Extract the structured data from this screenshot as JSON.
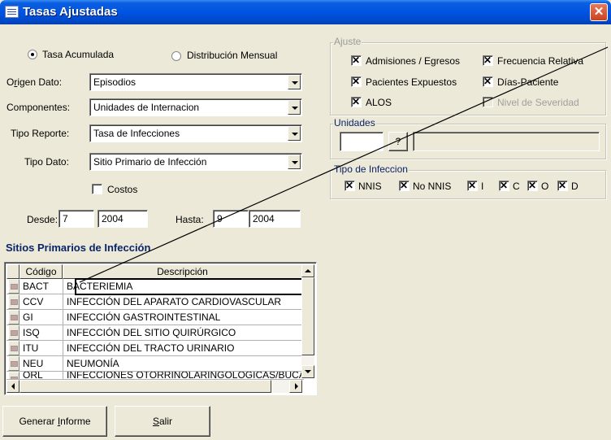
{
  "window": {
    "title": "Tasas Ajustadas",
    "close_glyph": "✕"
  },
  "rate_mode": {
    "accumulated_label": "Tasa Acumulada",
    "monthly_label": "Distribución Mensual",
    "selected": "accumulated"
  },
  "form": {
    "origen_label_pre": "O",
    "origen_label_ul": "r",
    "origen_label_post": "igen Dato:",
    "origen_value": "Episodios",
    "componentes_label": "Componentes:",
    "componentes_value": "Unidades de Internacion",
    "tipo_reporte_label": "Tipo Reporte:",
    "tipo_reporte_value": "Tasa de Infecciones",
    "tipo_dato_label": "Tipo Dato:",
    "tipo_dato_value": "Sitio Primario de Infección",
    "costos_label": "Costos",
    "desde_label": "Desde:",
    "desde_month": "7",
    "desde_year": "2004",
    "hasta_label": "Hasta:",
    "hasta_month": "9",
    "hasta_year": "2004"
  },
  "ajuste": {
    "title": "Ajuste",
    "items": [
      {
        "label": "Admisiones / Egresos",
        "checked": true
      },
      {
        "label": "Frecuencia Relativa",
        "checked": true
      },
      {
        "label": "Pacientes Expuestos",
        "checked": true
      },
      {
        "label": "Días-Paciente",
        "checked": true
      },
      {
        "label": "ALOS",
        "checked": true
      },
      {
        "label": "Nivel de Severidad",
        "checked": false,
        "disabled": true
      }
    ]
  },
  "unidades": {
    "title": "Unidades",
    "code_value": "",
    "lookup_label": "?",
    "name_value": ""
  },
  "tipo_infeccion": {
    "title": "Tipo de Infeccion",
    "items": [
      {
        "label": "NNIS",
        "checked": true
      },
      {
        "label": "No NNIS",
        "checked": true
      },
      {
        "label": "I",
        "checked": true
      },
      {
        "label": "C",
        "checked": true
      },
      {
        "label": "O",
        "checked": true
      },
      {
        "label": "D",
        "checked": true
      }
    ]
  },
  "sites": {
    "title": "Sitios Primarios de Infección",
    "columns": [
      "Código",
      "Descripción"
    ],
    "rows": [
      {
        "code": "BACT",
        "desc": "BACTERIEMIA"
      },
      {
        "code": "CCV",
        "desc": "INFECCIÓN DEL APARATO CARDIOVASCULAR"
      },
      {
        "code": "GI",
        "desc": "INFECCIÓN GASTROINTESTINAL"
      },
      {
        "code": "ISQ",
        "desc": "INFECCIÓN DEL SITIO QUIRÚRGICO"
      },
      {
        "code": "ITU",
        "desc": "INFECCIÓN DEL TRACTO URINARIO"
      },
      {
        "code": "NEU",
        "desc": "NEUMONÍA"
      },
      {
        "code": "ORL",
        "desc": "INFECCIONES OTORRINOLARINGOLÓGICAS/BUCALES"
      }
    ]
  },
  "buttons": {
    "generar_pre": "Generar ",
    "generar_ul": "I",
    "generar_post": "nforme",
    "salir_ul": "S",
    "salir_post": "alir"
  },
  "colors": {
    "title_bar": "#0054E3",
    "section_title": "#0A246A",
    "face": "#ECE9D8"
  }
}
